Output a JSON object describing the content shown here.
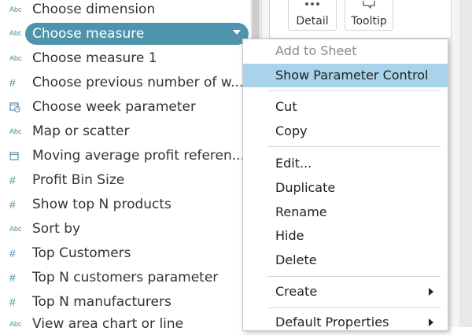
{
  "parameters": [
    {
      "icon": "abc-icon",
      "icon_text": "Abc",
      "label": "Choose dimension"
    },
    {
      "icon": "abc-icon",
      "icon_text": "Abc",
      "label": "Choose measure",
      "selected": true
    },
    {
      "icon": "abc-icon",
      "icon_text": "Abc",
      "label": "Choose measure 1"
    },
    {
      "icon": "number-icon",
      "icon_text": "#",
      "label": "Choose previous number of w..."
    },
    {
      "icon": "datetime-icon",
      "icon_text": "",
      "label": "Choose week parameter"
    },
    {
      "icon": "abc-icon",
      "icon_text": "Abc",
      "label": "Map or scatter"
    },
    {
      "icon": "date-icon",
      "icon_text": "",
      "label": "Moving average profit referen..."
    },
    {
      "icon": "number-icon",
      "icon_text": "#",
      "label": "Profit Bin Size"
    },
    {
      "icon": "number-icon",
      "icon_text": "#",
      "label": "Show top N products"
    },
    {
      "icon": "abc-icon",
      "icon_text": "Abc",
      "label": "Sort by"
    },
    {
      "icon": "number-icon",
      "icon_text": "#",
      "label": "Top Customers"
    },
    {
      "icon": "number-icon",
      "icon_text": "#",
      "label": "Top N customers parameter"
    },
    {
      "icon": "number-icon",
      "icon_text": "#",
      "label": "Top N manufacturers"
    },
    {
      "icon": "abc-icon",
      "icon_text": "Abc",
      "label": "View area chart or line"
    }
  ],
  "marks_card": {
    "detail_label": "Detail",
    "tooltip_label": "Tooltip"
  },
  "context_menu": {
    "add_to_sheet": "Add to Sheet",
    "show_parameter_control": "Show Parameter Control",
    "cut": "Cut",
    "copy": "Copy",
    "edit": "Edit...",
    "duplicate": "Duplicate",
    "rename": "Rename",
    "hide": "Hide",
    "delete": "Delete",
    "create": "Create",
    "default_properties": "Default Properties"
  },
  "colors": {
    "selected_pill": "#4f94ad",
    "menu_highlight": "#a8d3ea",
    "icon_accent": "#4f8fa6"
  }
}
